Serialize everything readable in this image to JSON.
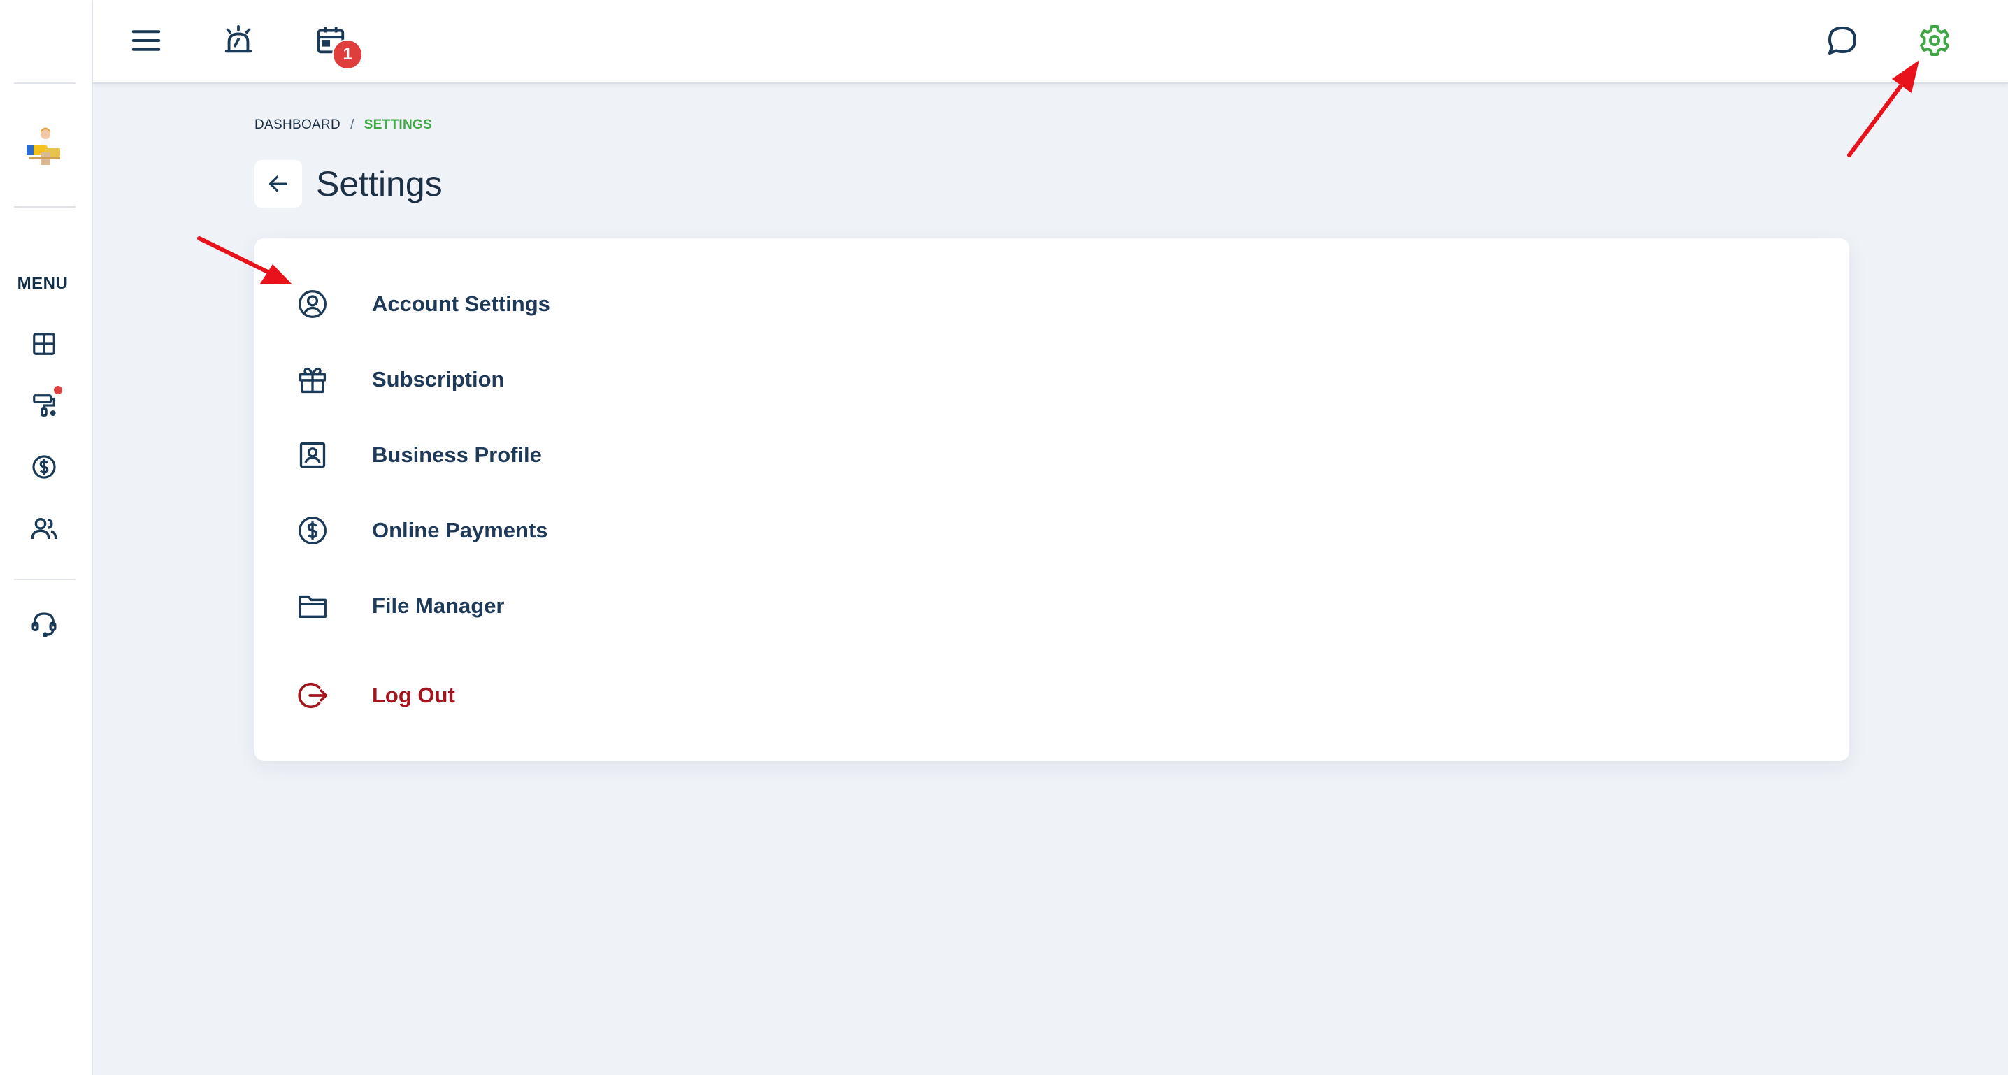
{
  "sidebar": {
    "menu_label": "MENU",
    "items": [
      {
        "icon": "dashboard-layout-icon"
      },
      {
        "icon": "paint-roller-icon",
        "has_notification_dot": true
      },
      {
        "icon": "dollar-circle-icon"
      },
      {
        "icon": "users-icon"
      },
      {
        "icon": "headset-support-icon"
      }
    ]
  },
  "topbar": {
    "icons": [
      "hamburger-menu-icon",
      "alarm-icon",
      "calendar-icon",
      "chat-icon",
      "gear-icon"
    ],
    "calendar_badge": "1",
    "active_color": "#3fa845"
  },
  "breadcrumb": {
    "root": "DASHBOARD",
    "separator": "/",
    "current": "SETTINGS"
  },
  "page": {
    "title": "Settings"
  },
  "settings_menu": {
    "items": [
      {
        "label": "Account Settings",
        "icon": "user-circle-icon"
      },
      {
        "label": "Subscription",
        "icon": "gift-icon"
      },
      {
        "label": "Business Profile",
        "icon": "profile-card-icon"
      },
      {
        "label": "Online Payments",
        "icon": "dollar-circle-icon"
      },
      {
        "label": "File Manager",
        "icon": "folder-icon"
      }
    ],
    "logout": {
      "label": "Log Out",
      "icon": "logout-icon",
      "color": "#a3141c"
    }
  },
  "colors": {
    "background": "#eff2f7",
    "text": "#1b3a57",
    "accent_green": "#3fa845",
    "badge_red": "#e03d3d",
    "annotation_red": "#e8121a"
  }
}
